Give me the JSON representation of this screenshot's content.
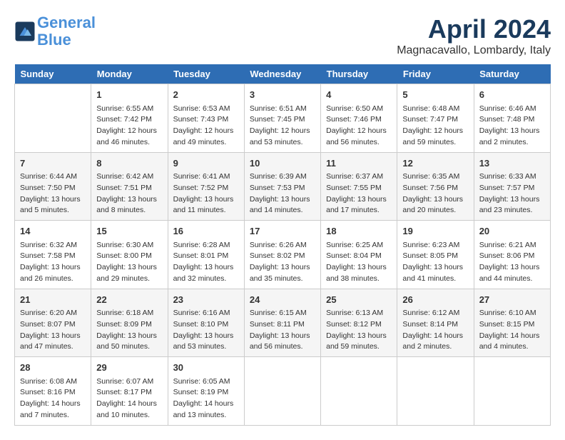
{
  "header": {
    "logo_line1": "General",
    "logo_line2": "Blue",
    "month_year": "April 2024",
    "location": "Magnacavallo, Lombardy, Italy"
  },
  "days_of_week": [
    "Sunday",
    "Monday",
    "Tuesday",
    "Wednesday",
    "Thursday",
    "Friday",
    "Saturday"
  ],
  "weeks": [
    [
      {
        "day": "",
        "info": ""
      },
      {
        "day": "1",
        "info": "Sunrise: 6:55 AM\nSunset: 7:42 PM\nDaylight: 12 hours\nand 46 minutes."
      },
      {
        "day": "2",
        "info": "Sunrise: 6:53 AM\nSunset: 7:43 PM\nDaylight: 12 hours\nand 49 minutes."
      },
      {
        "day": "3",
        "info": "Sunrise: 6:51 AM\nSunset: 7:45 PM\nDaylight: 12 hours\nand 53 minutes."
      },
      {
        "day": "4",
        "info": "Sunrise: 6:50 AM\nSunset: 7:46 PM\nDaylight: 12 hours\nand 56 minutes."
      },
      {
        "day": "5",
        "info": "Sunrise: 6:48 AM\nSunset: 7:47 PM\nDaylight: 12 hours\nand 59 minutes."
      },
      {
        "day": "6",
        "info": "Sunrise: 6:46 AM\nSunset: 7:48 PM\nDaylight: 13 hours\nand 2 minutes."
      }
    ],
    [
      {
        "day": "7",
        "info": "Sunrise: 6:44 AM\nSunset: 7:50 PM\nDaylight: 13 hours\nand 5 minutes."
      },
      {
        "day": "8",
        "info": "Sunrise: 6:42 AM\nSunset: 7:51 PM\nDaylight: 13 hours\nand 8 minutes."
      },
      {
        "day": "9",
        "info": "Sunrise: 6:41 AM\nSunset: 7:52 PM\nDaylight: 13 hours\nand 11 minutes."
      },
      {
        "day": "10",
        "info": "Sunrise: 6:39 AM\nSunset: 7:53 PM\nDaylight: 13 hours\nand 14 minutes."
      },
      {
        "day": "11",
        "info": "Sunrise: 6:37 AM\nSunset: 7:55 PM\nDaylight: 13 hours\nand 17 minutes."
      },
      {
        "day": "12",
        "info": "Sunrise: 6:35 AM\nSunset: 7:56 PM\nDaylight: 13 hours\nand 20 minutes."
      },
      {
        "day": "13",
        "info": "Sunrise: 6:33 AM\nSunset: 7:57 PM\nDaylight: 13 hours\nand 23 minutes."
      }
    ],
    [
      {
        "day": "14",
        "info": "Sunrise: 6:32 AM\nSunset: 7:58 PM\nDaylight: 13 hours\nand 26 minutes."
      },
      {
        "day": "15",
        "info": "Sunrise: 6:30 AM\nSunset: 8:00 PM\nDaylight: 13 hours\nand 29 minutes."
      },
      {
        "day": "16",
        "info": "Sunrise: 6:28 AM\nSunset: 8:01 PM\nDaylight: 13 hours\nand 32 minutes."
      },
      {
        "day": "17",
        "info": "Sunrise: 6:26 AM\nSunset: 8:02 PM\nDaylight: 13 hours\nand 35 minutes."
      },
      {
        "day": "18",
        "info": "Sunrise: 6:25 AM\nSunset: 8:04 PM\nDaylight: 13 hours\nand 38 minutes."
      },
      {
        "day": "19",
        "info": "Sunrise: 6:23 AM\nSunset: 8:05 PM\nDaylight: 13 hours\nand 41 minutes."
      },
      {
        "day": "20",
        "info": "Sunrise: 6:21 AM\nSunset: 8:06 PM\nDaylight: 13 hours\nand 44 minutes."
      }
    ],
    [
      {
        "day": "21",
        "info": "Sunrise: 6:20 AM\nSunset: 8:07 PM\nDaylight: 13 hours\nand 47 minutes."
      },
      {
        "day": "22",
        "info": "Sunrise: 6:18 AM\nSunset: 8:09 PM\nDaylight: 13 hours\nand 50 minutes."
      },
      {
        "day": "23",
        "info": "Sunrise: 6:16 AM\nSunset: 8:10 PM\nDaylight: 13 hours\nand 53 minutes."
      },
      {
        "day": "24",
        "info": "Sunrise: 6:15 AM\nSunset: 8:11 PM\nDaylight: 13 hours\nand 56 minutes."
      },
      {
        "day": "25",
        "info": "Sunrise: 6:13 AM\nSunset: 8:12 PM\nDaylight: 13 hours\nand 59 minutes."
      },
      {
        "day": "26",
        "info": "Sunrise: 6:12 AM\nSunset: 8:14 PM\nDaylight: 14 hours\nand 2 minutes."
      },
      {
        "day": "27",
        "info": "Sunrise: 6:10 AM\nSunset: 8:15 PM\nDaylight: 14 hours\nand 4 minutes."
      }
    ],
    [
      {
        "day": "28",
        "info": "Sunrise: 6:08 AM\nSunset: 8:16 PM\nDaylight: 14 hours\nand 7 minutes."
      },
      {
        "day": "29",
        "info": "Sunrise: 6:07 AM\nSunset: 8:17 PM\nDaylight: 14 hours\nand 10 minutes."
      },
      {
        "day": "30",
        "info": "Sunrise: 6:05 AM\nSunset: 8:19 PM\nDaylight: 14 hours\nand 13 minutes."
      },
      {
        "day": "",
        "info": ""
      },
      {
        "day": "",
        "info": ""
      },
      {
        "day": "",
        "info": ""
      },
      {
        "day": "",
        "info": ""
      }
    ]
  ]
}
